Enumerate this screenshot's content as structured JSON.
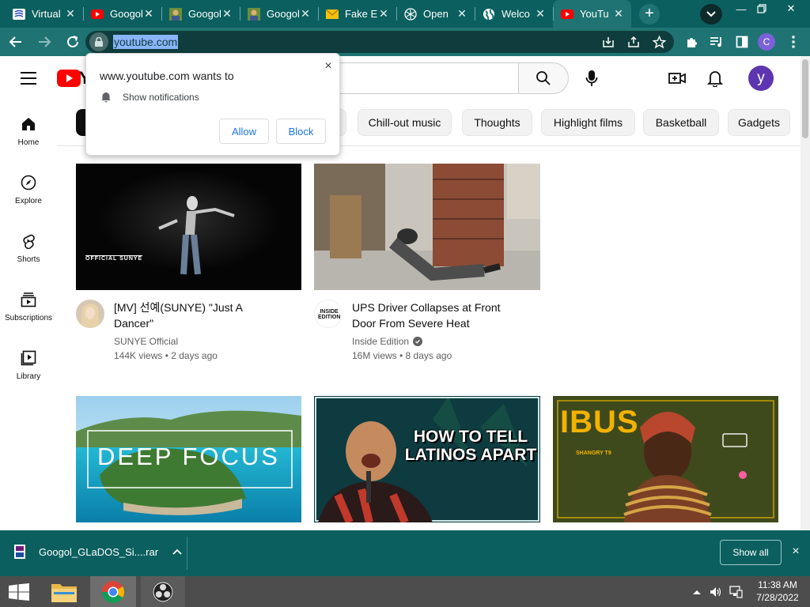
{
  "browser": {
    "tabs": [
      {
        "title": "Virtual",
        "icon": "virtual-app-icon"
      },
      {
        "title": "Googol",
        "icon": "youtube-favicon"
      },
      {
        "title": "Googol",
        "icon": "image-favicon"
      },
      {
        "title": "Googol",
        "icon": "image-favicon"
      },
      {
        "title": "Fake E",
        "icon": "mail-favicon"
      },
      {
        "title": "Open",
        "icon": "openai-favicon"
      },
      {
        "title": "Welco",
        "icon": "globe-favicon"
      },
      {
        "title": "YouTu",
        "icon": "youtube-favicon"
      }
    ],
    "new_tab": "+",
    "url": "youtube.com",
    "profile_initial": "C",
    "accent": "#1f7373"
  },
  "notification_prompt": {
    "title": "www.youtube.com wants to",
    "permission": "Show notifications",
    "allow": "Allow",
    "block": "Block",
    "close": "×"
  },
  "youtube": {
    "logo_letter": "Y",
    "avatar_initial": "y",
    "sidebar": [
      {
        "label": "Home",
        "icon": "home-icon"
      },
      {
        "label": "Explore",
        "icon": "compass-icon"
      },
      {
        "label": "Shorts",
        "icon": "shorts-icon"
      },
      {
        "label": "Subscriptions",
        "icon": "subscriptions-icon"
      },
      {
        "label": "Library",
        "icon": "library-icon"
      }
    ],
    "chips": [
      "Chill-out music",
      "Thoughts",
      "Highlight films",
      "Basketball",
      "Gadgets"
    ],
    "videos": [
      {
        "title": "[MV] 선예(SUNYE) \"Just A Dancer\"",
        "channel": "SUNYE Official",
        "meta": "144K views • 2 days ago",
        "verified": false,
        "thumb_text": "OFFICIAL SUNYE"
      },
      {
        "title": "UPS Driver Collapses at Front Door From Severe Heat",
        "channel": "Inside Edition",
        "meta": "16M views • 8 days ago",
        "verified": true,
        "thumb_text": ""
      }
    ],
    "row2_thumbs": [
      {
        "text": "DEEP FOCUS"
      },
      {
        "text": "HOW TO TELL LATINOS APART"
      },
      {
        "text": "IBUS",
        "sub": "SHANGRY T9"
      }
    ],
    "channel_badge": "INSIDE EDITION"
  },
  "download_bar": {
    "file": "Googol_GLaDOS_Si....rar",
    "show_all": "Show all",
    "close": "×"
  },
  "taskbar": {
    "time": "11:38 AM",
    "date": "7/28/2022"
  }
}
